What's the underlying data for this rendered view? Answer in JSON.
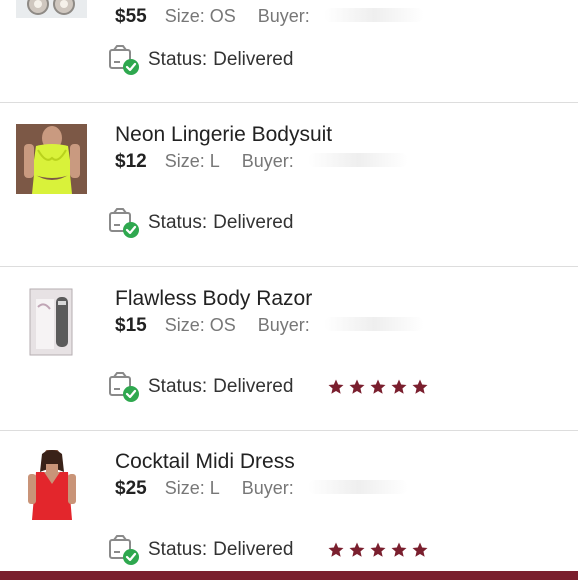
{
  "items": [
    {
      "title": "",
      "price": "$55",
      "size": "Size: OS",
      "buyer_label": "Buyer:",
      "status_label": "Status:",
      "status_value": "Delivered",
      "rating": 0,
      "thumb": "earrings"
    },
    {
      "title": "Neon Lingerie Bodysuit",
      "price": "$12",
      "size": "Size: L",
      "buyer_label": "Buyer:",
      "status_label": "Status:",
      "status_value": "Delivered",
      "rating": 0,
      "thumb": "neon-bodysuit"
    },
    {
      "title": "Flawless Body Razor",
      "price": "$15",
      "size": "Size: OS",
      "buyer_label": "Buyer:",
      "status_label": "Status:",
      "status_value": "Delivered",
      "rating": 5,
      "thumb": "razor-box"
    },
    {
      "title": "Cocktail Midi Dress",
      "price": "$25",
      "size": "Size: L",
      "buyer_label": "Buyer:",
      "status_label": "Status:",
      "status_value": "Delivered",
      "rating": 5,
      "thumb": "red-dress"
    }
  ],
  "colors": {
    "star": "#7a1f2e",
    "check": "#2fa84f",
    "bottom_bar": "#7a1f2e"
  }
}
